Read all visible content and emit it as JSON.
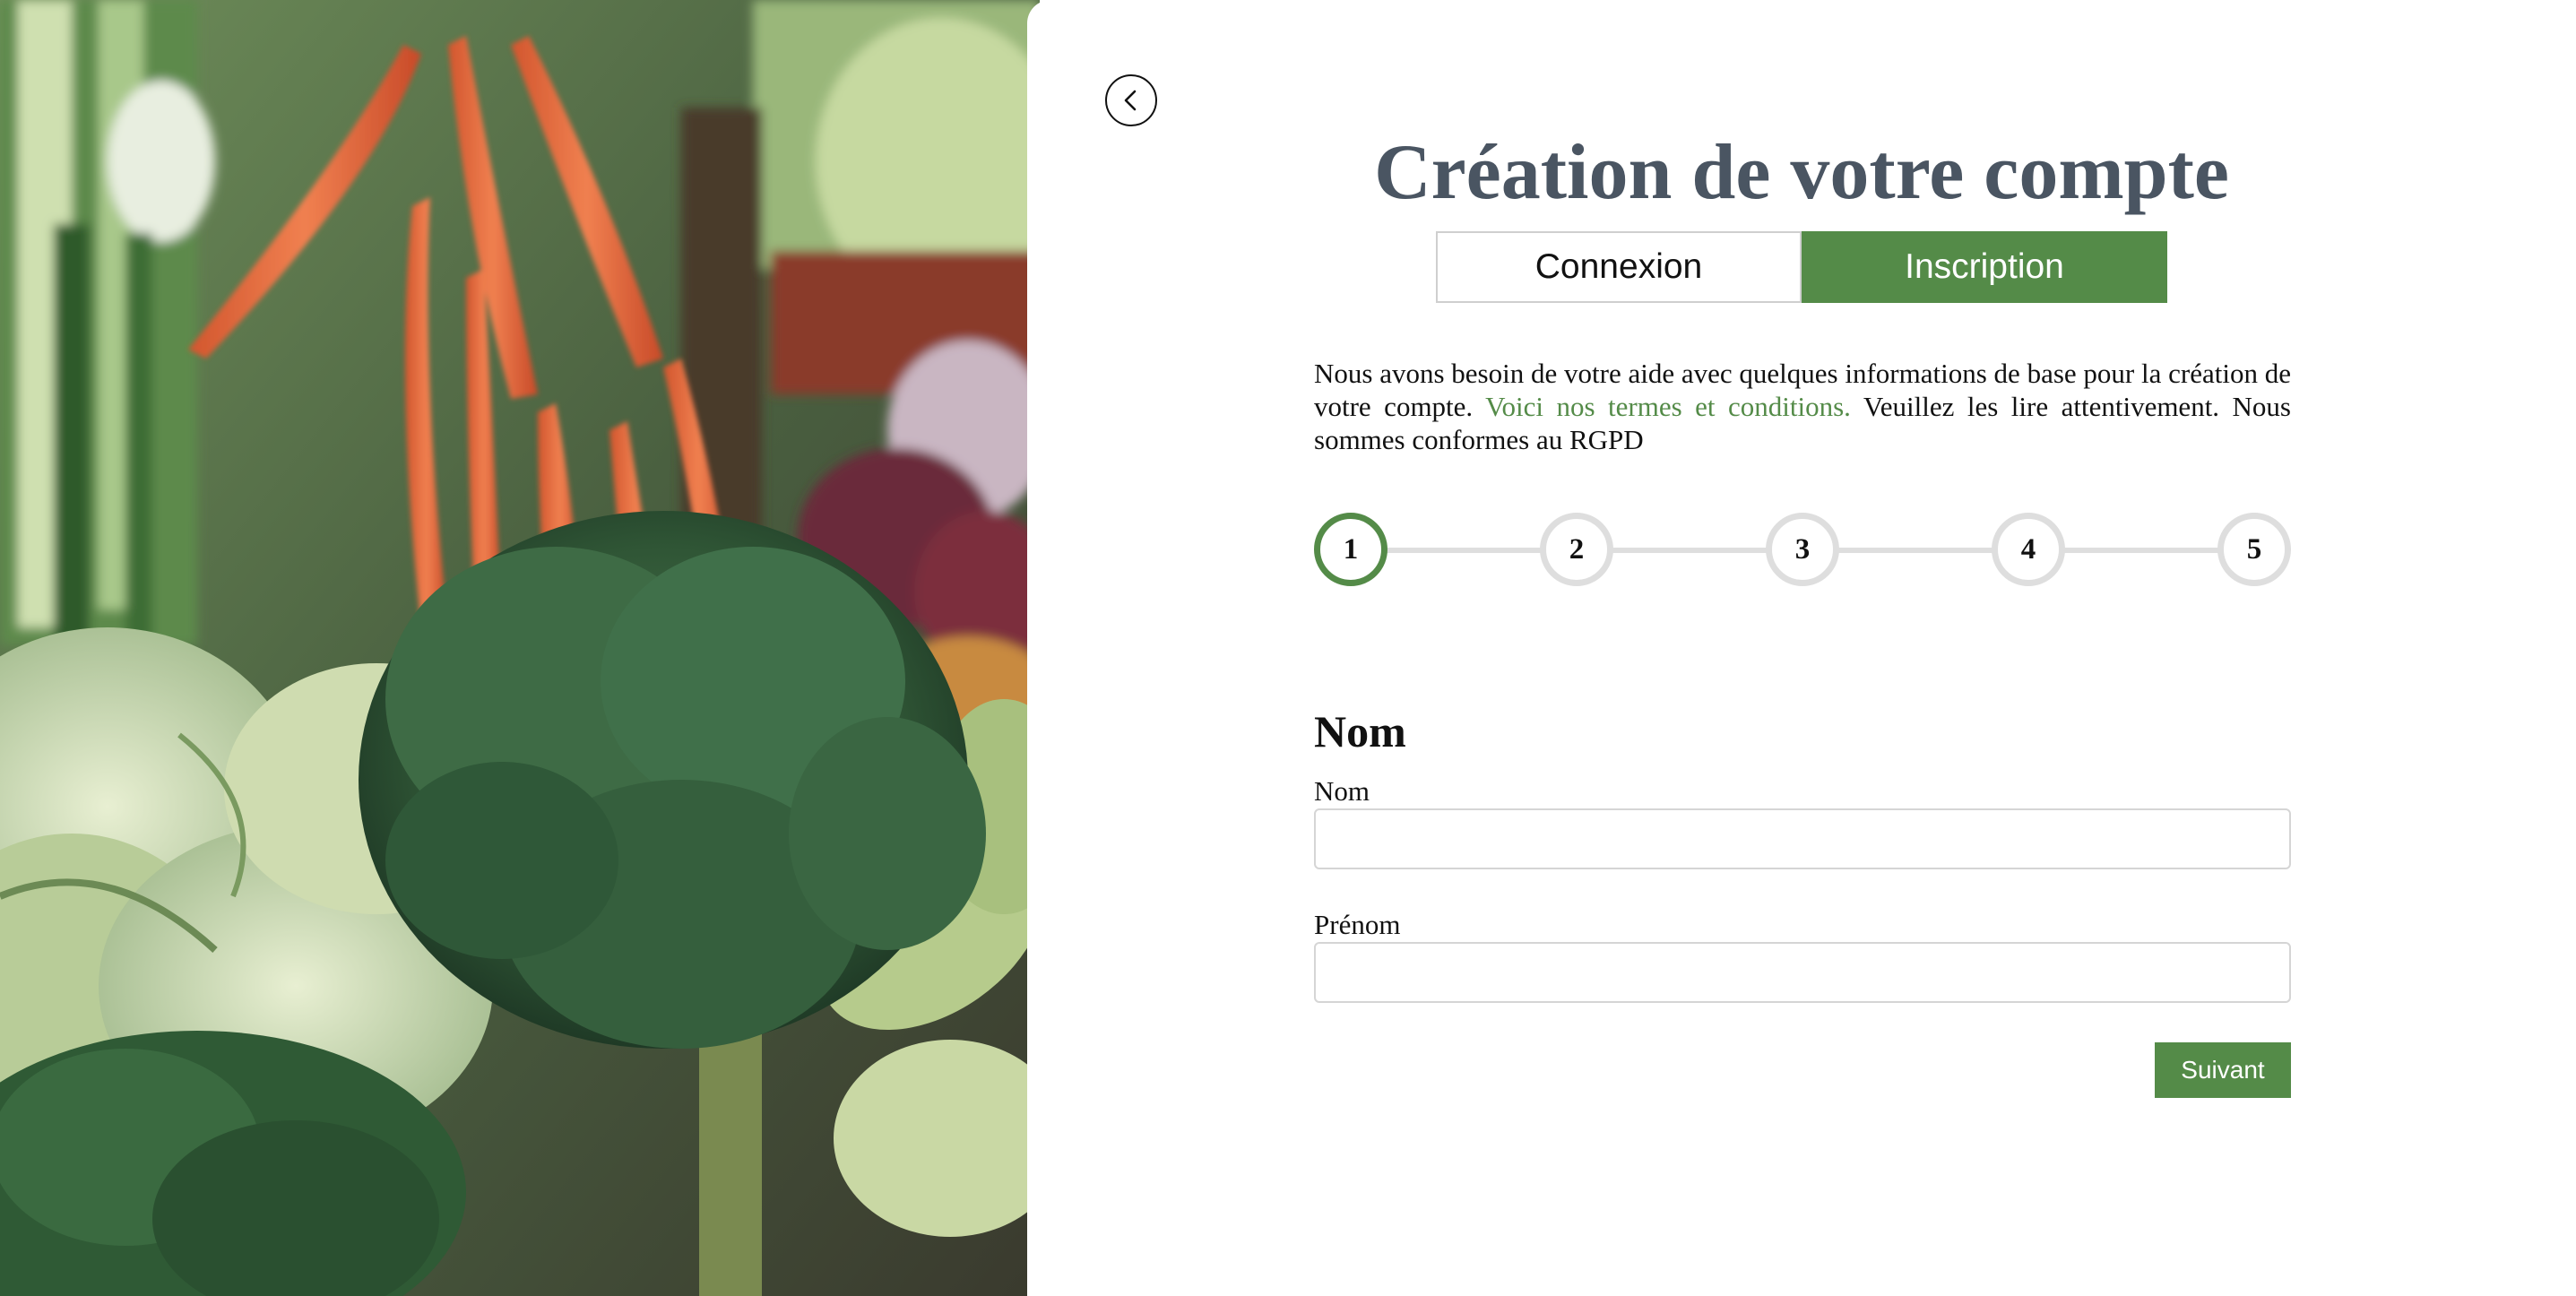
{
  "header": {
    "title": "Création de votre compte"
  },
  "tabs": [
    {
      "label": "Connexion",
      "active": false
    },
    {
      "label": "Inscription",
      "active": true
    }
  ],
  "intro": {
    "text_before": "Nous avons besoin de votre aide avec quelques informations de base pour la création de votre compte. ",
    "link_text": "Voici nos termes et conditions.",
    "text_after": " Veuillez les lire attentivement. Nous sommes conformes au RGPD"
  },
  "steps": [
    {
      "number": "1",
      "active": true
    },
    {
      "number": "2",
      "active": false
    },
    {
      "number": "3",
      "active": false
    },
    {
      "number": "4",
      "active": false
    },
    {
      "number": "5",
      "active": false
    }
  ],
  "form": {
    "section_title": "Nom",
    "fields": [
      {
        "label": "Nom",
        "value": "",
        "placeholder": ""
      },
      {
        "label": "Prénom",
        "value": "",
        "placeholder": ""
      }
    ],
    "next_label": "Suivant"
  },
  "icons": {
    "back": "chevron-left-icon"
  },
  "colors": {
    "accent": "#548b48",
    "title": "#4a5562",
    "step_inactive": "#dedede"
  }
}
